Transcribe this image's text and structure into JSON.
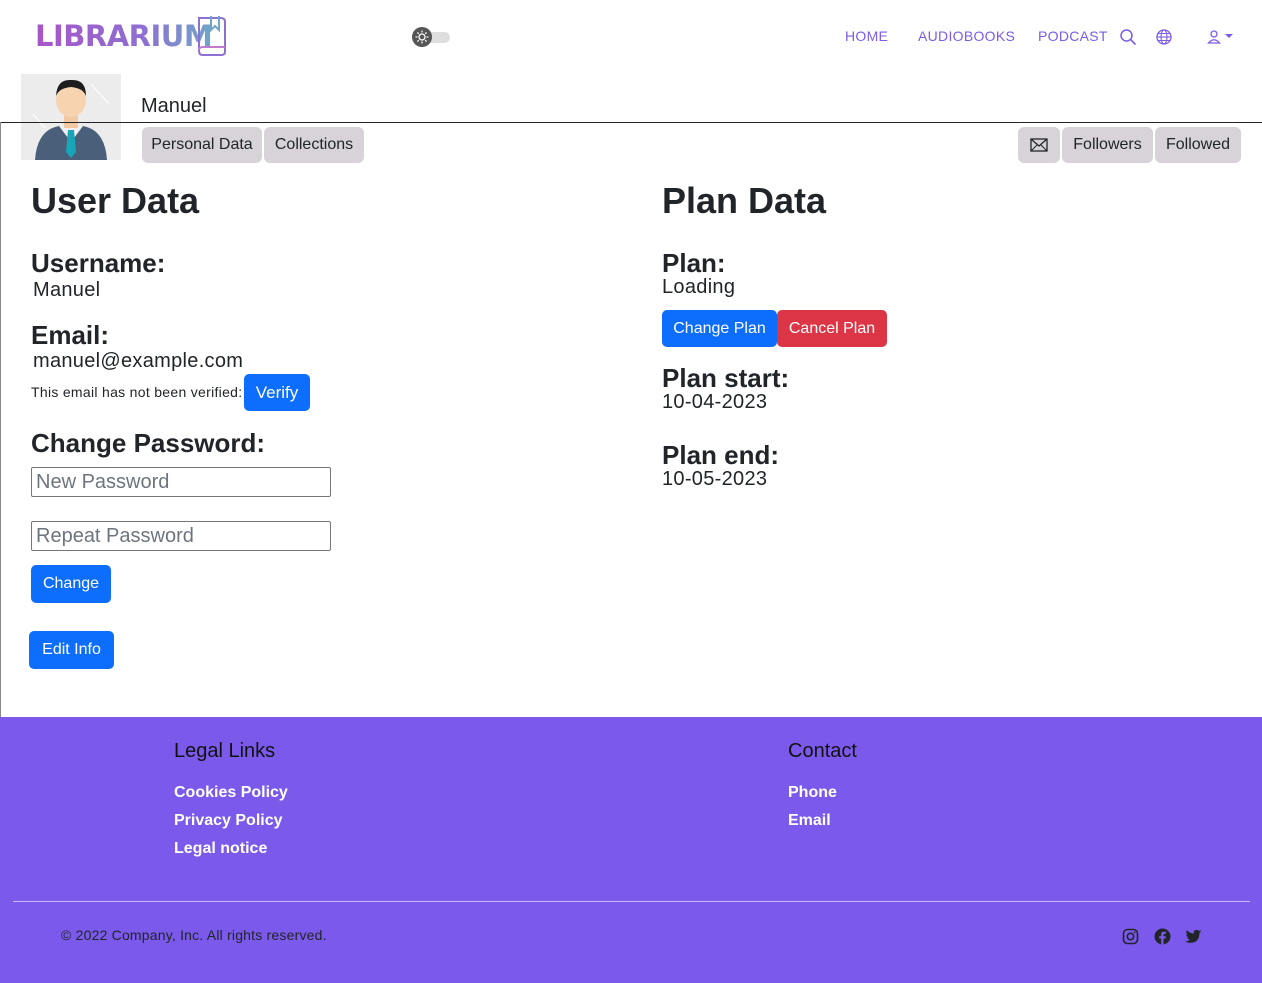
{
  "brand": {
    "name": "LIBRARIUM",
    "gradient_start": "#a855c7",
    "gradient_end": "#6fa6c8"
  },
  "nav": {
    "home": "HOME",
    "audiobooks": "AUDIOBOOKS",
    "podcast": "PODCAST",
    "icons": [
      "search-icon",
      "globe-icon",
      "user-icon"
    ]
  },
  "profile": {
    "name": "Manuel",
    "tabs": {
      "personal": "Personal Data",
      "collections": "Collections"
    },
    "right_tabs": {
      "followers": "Followers",
      "followed": "Followed"
    }
  },
  "user_data": {
    "title": "User Data",
    "username_label": "Username:",
    "username": "Manuel",
    "email_label": "Email:",
    "email": "manuel@example.com",
    "verify_note": "This email has not been verified:",
    "verify_button": "Verify",
    "change_password_label": "Change Password:",
    "new_password_placeholder": "New Password",
    "repeat_password_placeholder": "Repeat Password",
    "change_button": "Change",
    "edit_button": "Edit Info"
  },
  "plan_data": {
    "title": "Plan Data",
    "plan_label": "Plan:",
    "plan": "Loading",
    "change_plan_button": "Change Plan",
    "cancel_plan_button": "Cancel Plan",
    "start_label": "Plan start:",
    "start": "10-04-2023",
    "end_label": "Plan end:",
    "end": "10-05-2023"
  },
  "footer": {
    "legal_heading": "Legal Links",
    "legal_links": [
      "Cookies Policy",
      "Privacy Policy",
      "Legal notice"
    ],
    "contact_heading": "Contact",
    "contact_links": [
      "Phone",
      "Email"
    ],
    "copyright": "© 2022 Company, Inc. All rights reserved.",
    "social_icons": [
      "instagram-icon",
      "facebook-icon",
      "twitter-icon"
    ],
    "background": "#7b5aeb"
  },
  "colors": {
    "primary": "#0d6efd",
    "danger": "#dc3545",
    "nav_link": "#7c5ce6",
    "tab_bg": "#d8d3d8"
  }
}
